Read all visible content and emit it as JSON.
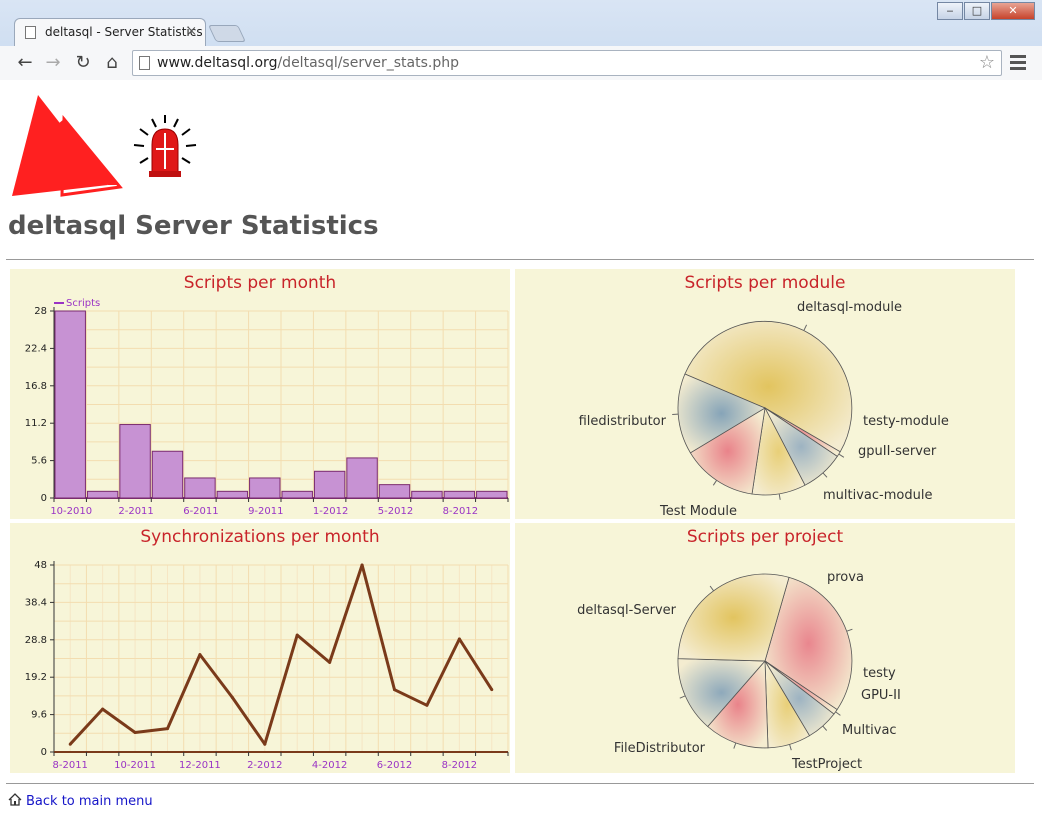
{
  "browser": {
    "tab_title": "deltasql - Server Statistics",
    "tab_close": "×",
    "url_host": "www.deltasql.org",
    "url_path": "/deltasql/server_stats.php",
    "window_buttons": [
      "‒",
      "□",
      "✕"
    ],
    "nav_icons": [
      "back-icon",
      "forward-icon",
      "reload-icon",
      "home-icon"
    ],
    "back_glyph": "←",
    "forward_glyph": "→",
    "reload_glyph": "↻",
    "home_glyph": "⌂",
    "star_glyph": "☆"
  },
  "page": {
    "heading": "deltasql Server Statistics",
    "back_link": "Back to main menu"
  },
  "chart_data": [
    {
      "type": "bar",
      "title": "Scripts per month",
      "legend": "Scripts",
      "legend_position": "top-left",
      "color": "#c792d3",
      "ylim": [
        0,
        28
      ],
      "yticks": [
        "0",
        "5.6",
        "11.2",
        "16.8",
        "22.4",
        "28"
      ],
      "xticks": [
        "10-2010",
        "2-2011",
        "6-2011",
        "9-2011",
        "1-2012",
        "5-2012",
        "8-2012"
      ],
      "values": [
        28,
        1,
        11,
        7,
        3,
        1,
        3,
        1,
        4,
        6,
        2,
        1,
        1,
        1
      ]
    },
    {
      "type": "pie",
      "title": "Scripts per module",
      "slices": [
        {
          "label": "deltasql-module",
          "value": 52,
          "color": "#e2c45f"
        },
        {
          "label": "testy-module",
          "value": 1,
          "color": "#ea9696"
        },
        {
          "label": "gpuII-server",
          "value": 8,
          "color": "#9db3c2"
        },
        {
          "label": "multivac-module",
          "value": 10,
          "color": "#e8cf78"
        },
        {
          "label": "Test Module",
          "value": 14,
          "color": "#e9838a"
        },
        {
          "label": "filedistributor",
          "value": 15,
          "color": "#86a4b8"
        }
      ]
    },
    {
      "type": "line",
      "title": "Synchronizations per month",
      "color": "#7a3a1a",
      "ylim": [
        0,
        48
      ],
      "yticks": [
        "0",
        "9.6",
        "19.2",
        "28.8",
        "38.4",
        "48"
      ],
      "xticks": [
        "8-2011",
        "10-2011",
        "12-2011",
        "2-2012",
        "4-2012",
        "6-2012",
        "8-2012"
      ],
      "values": [
        2,
        11,
        5,
        6,
        25,
        14,
        2,
        30,
        23,
        48,
        16,
        12,
        29,
        16
      ]
    },
    {
      "type": "pie",
      "title": "Scripts per project",
      "slices": [
        {
          "label": "prova",
          "value": 30,
          "color": "#e9868e"
        },
        {
          "label": "testy",
          "value": 1,
          "color": "#ea9b9b"
        },
        {
          "label": "GPU-II",
          "value": 6,
          "color": "#9db3c2"
        },
        {
          "label": "Multivac",
          "value": 8,
          "color": "#e8cf78"
        },
        {
          "label": "TestProject",
          "value": 12,
          "color": "#e9838a"
        },
        {
          "label": "FileDistributor",
          "value": 14,
          "color": "#8ea9bb"
        },
        {
          "label": "deltasql-Server",
          "value": 29,
          "color": "#e2c45f"
        }
      ]
    }
  ]
}
